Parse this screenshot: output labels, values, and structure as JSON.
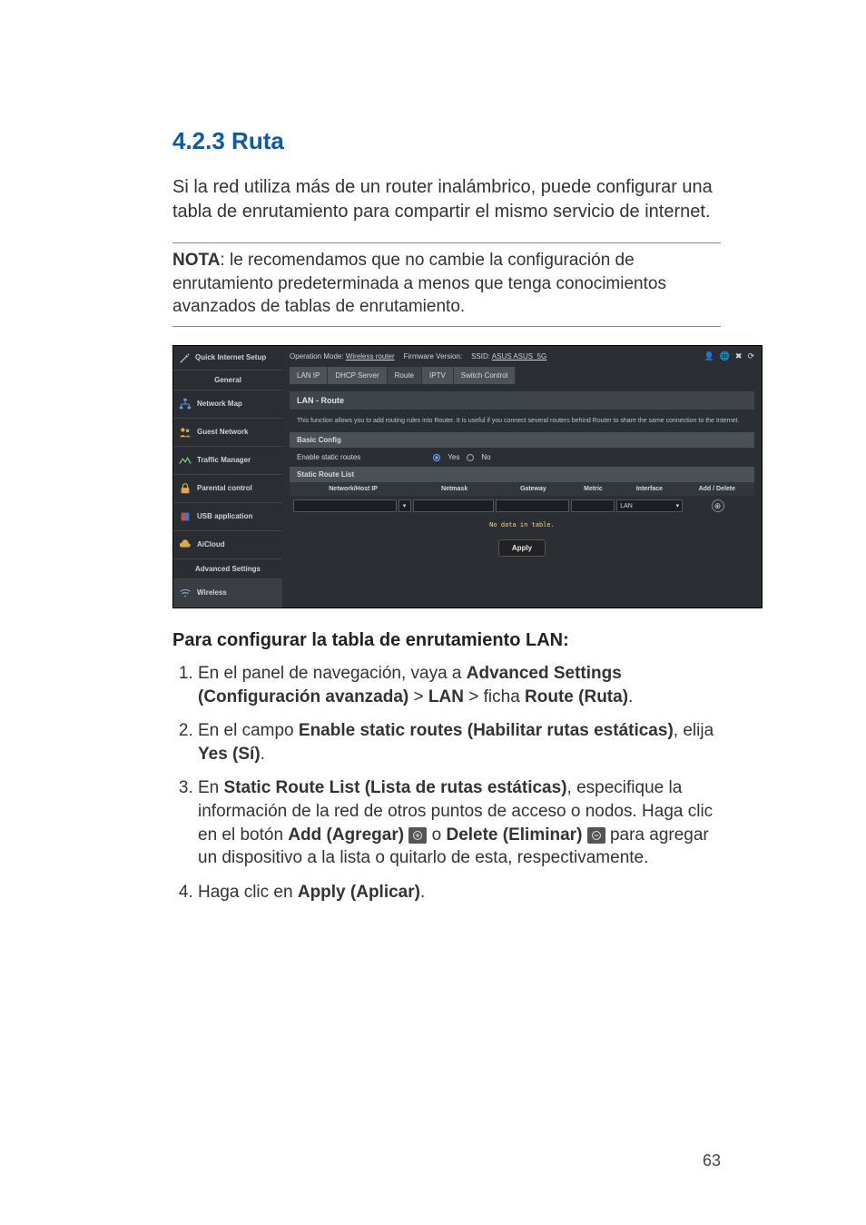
{
  "heading": "4.2.3 Ruta",
  "intro": "Si la red utiliza más de un router inalámbrico, puede configurar una tabla de enrutamiento para compartir el mismo servicio de internet.",
  "note_label": "NOTA",
  "note_body": ":  le recomendamos que no cambie la configuración de enrutamiento predeterminada a menos que tenga conocimientos avanzados de tablas de enrutamiento.",
  "router": {
    "top": {
      "op_mode_label": "Operation Mode:",
      "op_mode_value": "Wireless router",
      "fw_label": "Firmware Version:",
      "ssid_label": "SSID:",
      "ssid_value": "ASUS ASUS_5G"
    },
    "tabs": {
      "lan_ip": "LAN IP",
      "dhcp": "DHCP Server",
      "route": "Route",
      "iptv": "IPTV",
      "switch": "Switch Control"
    },
    "section_title": "LAN - Route",
    "section_desc": "This function allows you to add routing rules into Router. It is useful if you connect several routers behind Router to share the same connection to the Internet.",
    "basic_config": "Basic Config",
    "enable_static": "Enable static routes",
    "yes": "Yes",
    "no": "No",
    "static_list": "Static Route List",
    "cols": {
      "c1": "Network/Host IP",
      "c2": "Netmask",
      "c3": "Gateway",
      "c4": "Metric",
      "c5": "Interface",
      "c6": "Add / Delete"
    },
    "iface_value": "LAN",
    "no_data": "No data in table.",
    "apply": "Apply",
    "sidebar": {
      "qis": "Quick Internet Setup",
      "general": "General",
      "items": [
        "Network Map",
        "Guest Network",
        "Traffic Manager",
        "Parental control",
        "USB application",
        "AiCloud"
      ],
      "advanced": "Advanced Settings",
      "wireless": "Wireless"
    }
  },
  "proc_heading": "Para configurar la tabla de enrutamiento LAN:",
  "steps": {
    "s1a": "En el panel de navegación, vaya a ",
    "s1b": "Advanced Settings (Configuración avanzada)",
    "s1c": " > ",
    "s1d": "LAN",
    "s1e": " > ficha ",
    "s1f": "Route (Ruta)",
    "s1g": ".",
    "s2a": "En el campo ",
    "s2b": "Enable static routes (Habilitar rutas estáticas)",
    "s2c": ", elija ",
    "s2d": "Yes (Sí)",
    "s2e": ".",
    "s3a": "En ",
    "s3b": "Static Route List (Lista de rutas estáticas)",
    "s3c": ", especifique la información de la red de otros puntos de acceso o nodos. Haga clic en el botón ",
    "s3d": "Add (Agregar)",
    "s3e": " o ",
    "s3f": "Delete (Eliminar)",
    "s3g": " para agregar un dispositivo a la lista o quitarlo de esta, respectivamente.",
    "s4a": "Haga clic en ",
    "s4b": "Apply (Aplicar)",
    "s4c": "."
  },
  "page_number": "63"
}
